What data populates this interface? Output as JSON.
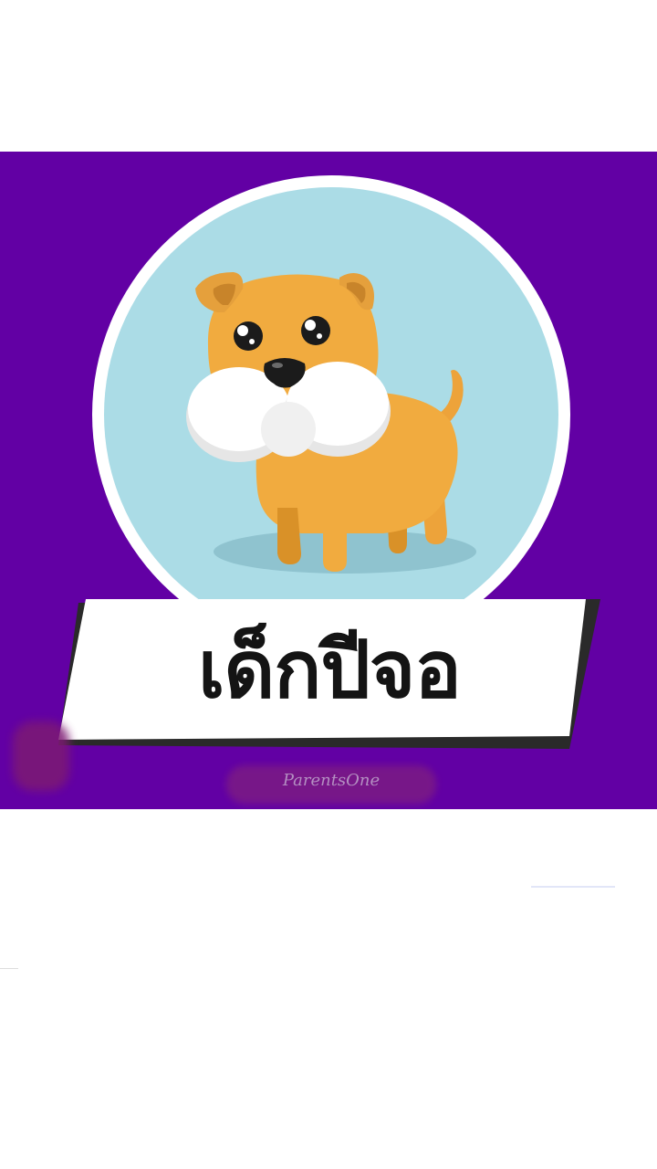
{
  "banner": {
    "title": "เด็กปีจอ",
    "background_color": "#6200a4"
  },
  "illustration": {
    "subject": "dog-illustration",
    "circle_color": "#abdce6",
    "dog_color": "#f1ab3f"
  },
  "watermark": {
    "text": "ParentsOne"
  }
}
